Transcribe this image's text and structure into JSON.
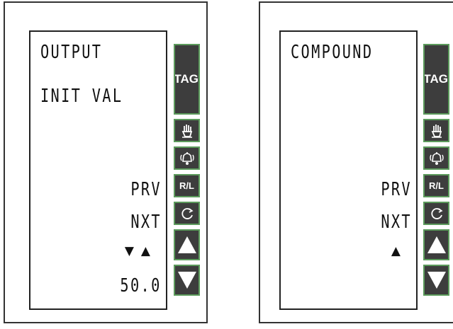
{
  "left_panel": {
    "line1": "OUTPUT",
    "line2": "INIT VAL",
    "prv": "PRV",
    "nxt": "NXT",
    "arrows": "▼▲",
    "value": "50.0"
  },
  "right_panel": {
    "line1": "COMPOUND",
    "prv": "PRV",
    "nxt": "NXT",
    "arrows": "▲"
  },
  "keys": {
    "tag": "TAG",
    "rl": "R/L",
    "icons": [
      "hand-icon",
      "bell-icon",
      "r-l-label",
      "refresh-icon",
      "up-arrow-icon",
      "down-arrow-icon"
    ]
  },
  "colors": {
    "key_fill": "#3d3d3d",
    "key_border": "#5c9b5c",
    "display_text": "#111111"
  }
}
